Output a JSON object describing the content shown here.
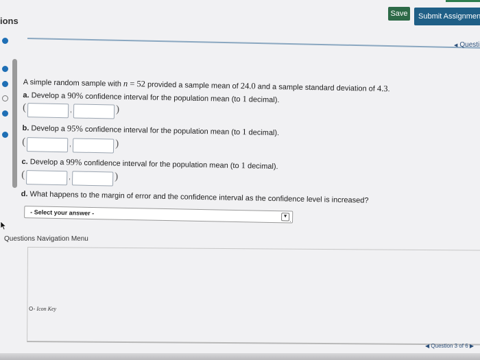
{
  "header": {
    "section_label": "ions",
    "save_label": "Save",
    "submit_label": "Submit Assignment f"
  },
  "sidebar": {
    "dots": [
      {
        "state": "answered"
      },
      {
        "state": "answered"
      },
      {
        "state": "answered"
      },
      {
        "state": "unanswered"
      },
      {
        "state": "answered"
      },
      {
        "state": "answered"
      }
    ]
  },
  "question_link": "Questi",
  "problem": {
    "intro_before": "A simple random sample with ",
    "n_symbol": "n",
    "n_equals": " = 52",
    "intro_mid": " provided a sample mean of ",
    "mean": "24.0",
    "intro_mid2": " and a sample standard deviation of ",
    "sd": "4.3",
    "intro_end": ".",
    "part_a_label": "a.",
    "part_a_pre": " Develop a ",
    "part_a_pct": "90%",
    "part_a_post": " confidence interval for the population mean (to ",
    "part_a_dec": "1",
    "part_a_end": " decimal).",
    "part_b_label": "b.",
    "part_b_pre": " Develop a ",
    "part_b_pct": "95%",
    "part_b_post": " confidence interval for the population mean (to ",
    "part_b_dec": "1",
    "part_b_end": " decimal).",
    "part_c_label": "c.",
    "part_c_pre": " Develop a ",
    "part_c_pct": "99%",
    "part_c_post": " confidence interval for the population mean (to ",
    "part_c_dec": "1",
    "part_c_end": " decimal).",
    "part_d_label": "d.",
    "part_d_text": " What happens to the margin of error and the confidence interval as the confidence level is increased?",
    "select_value": "- Select your answer -",
    "open_paren": "(",
    "close_paren": ")",
    "comma": ","
  },
  "nav": {
    "menu_label": "Questions Navigation Menu",
    "icon_key_label": "Icon Key",
    "question_counter": "Question 3 of 6"
  },
  "colors": {
    "save_button": "#2d6a47",
    "submit_button": "#1f5f86",
    "dot_active": "#1f6fb5"
  }
}
